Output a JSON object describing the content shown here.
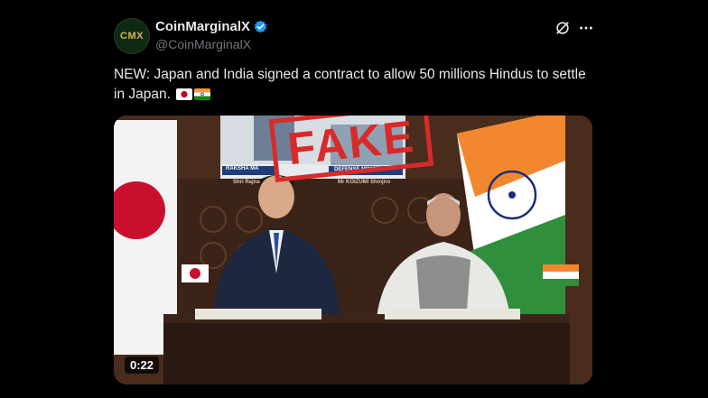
{
  "post": {
    "avatar_text": "CMX",
    "display_name": "CoinMarginalX",
    "handle": "@CoinMarginalX",
    "text": "NEW: Japan and India signed a contract to allow 50 millions Hindus to settle in Japan.",
    "flags": [
      "japan-flag-emoji",
      "india-flag-emoji"
    ]
  },
  "media": {
    "stamp_text": "FAKE",
    "video_time": "0:22",
    "banner_left_title": "RAKSHA MA",
    "banner_left_name": "Shri Rajna",
    "banner_right_title": "DEFENSE MINISTER",
    "banner_right_name": "Mr KOIZUMI Shinjiro"
  },
  "colors": {
    "background": "#000000",
    "text": "#e7e9ea",
    "muted": "#71767b",
    "verified": "#1d9bf0",
    "stamp": "#d92a2a"
  },
  "icons": {
    "verified": "verified-badge-icon",
    "grok": "grok-icon",
    "more": "more-icon"
  }
}
